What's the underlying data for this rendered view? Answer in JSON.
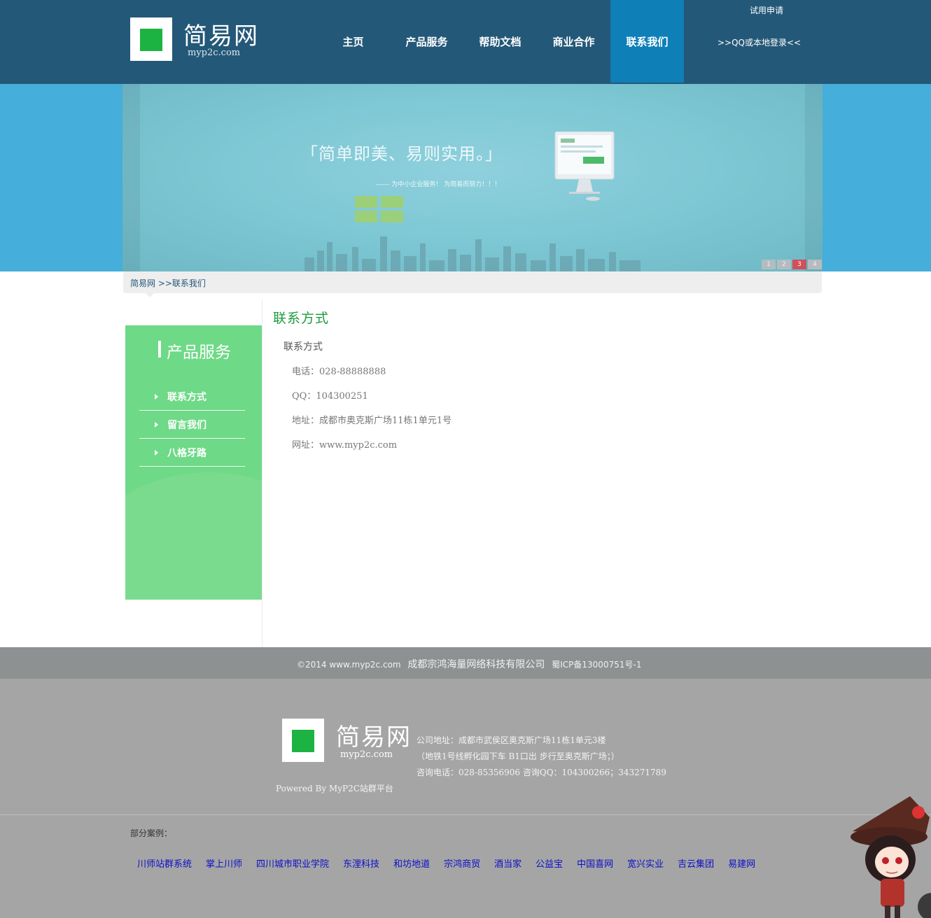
{
  "header": {
    "logo_title": "简易网",
    "logo_sub": "myp2c.com",
    "nav": [
      "主页",
      "产品服务",
      "帮助文档",
      "商业合作",
      "联系我们"
    ],
    "active_nav": "联系我们",
    "trial": "试用申请",
    "login": ">>QQ或本地登录<<"
  },
  "banner": {
    "slogan": "「简单即美、易则实用。」",
    "slogan_sub": "------ 为中小企业服务！ 为简易而努力！！！",
    "pager": [
      "1",
      "2",
      "3",
      "4"
    ],
    "active_page": "3"
  },
  "breadcrumb": {
    "text": "简易网 >>联系我们"
  },
  "sidebar": {
    "title": "产品服务",
    "items": [
      "联系方式",
      "留言我们",
      "八格牙路"
    ]
  },
  "content": {
    "title": "联系方式",
    "subtitle": "联系方式",
    "phone": "电话：028-88888888",
    "qq": "QQ：104300251",
    "address": "地址：成都市奥克斯广场11栋1单元1号",
    "website": "网址：www.myp2c.com"
  },
  "footbar": {
    "copyright": "©2014  www.myp2c.com",
    "company": "成都宗鸿海量网络科技有限公司",
    "icp": "蜀ICP备13000751号-1"
  },
  "footer": {
    "logo_title": "简易网",
    "logo_sub": "myp2c.com",
    "addr1": "公司地址：成都市武侯区奥克斯广场11栋1单元3楼",
    "addr2": "（地铁1号线孵化园下车 B1口出 步行至奥克斯广场；）",
    "addr3": "咨询电话：028-85356906 咨询QQ：104300266；343271789",
    "powered": "Powered By MyP2C站群平台",
    "cases_label": "部分案例：",
    "cases": [
      "川师站群系统",
      "掌上川师",
      "四川城市职业学院",
      "东浬科技",
      "和坊地道",
      "宗鸿商贸",
      "酒当家",
      "公益宝",
      "中国喜网",
      "宽兴实业",
      "吉云集团",
      "易建网"
    ]
  },
  "colors": {
    "header_bg": "#245878",
    "nav_active": "#0f7fb8",
    "banner_bg": "#45aedb",
    "sidebar_bg": "#6ed987",
    "title_green": "#1c9a3c",
    "link_blue": "#0b0fc8"
  }
}
